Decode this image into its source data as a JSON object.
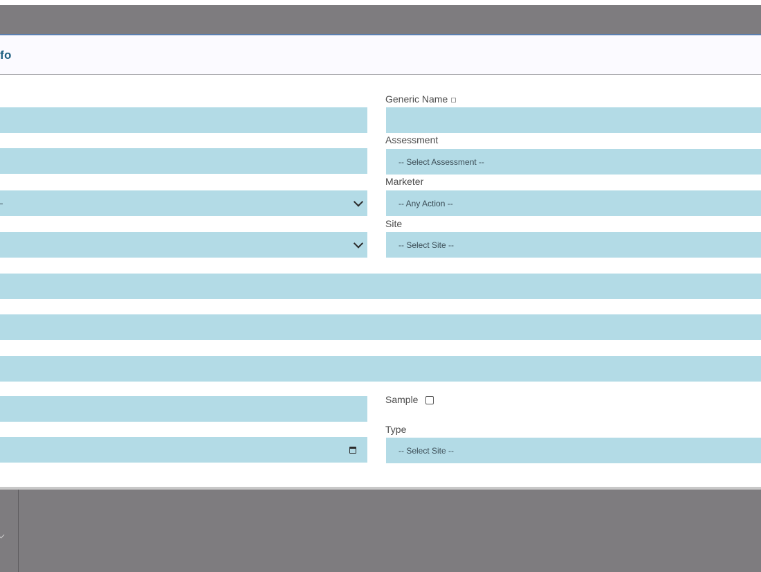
{
  "panel": {
    "title": "fo"
  },
  "fields": {
    "generic_name": {
      "label": "Generic Name",
      "value": ""
    },
    "assessment": {
      "label": "Assessment",
      "selected": "-- Select Assessment --"
    },
    "marketer": {
      "label": "Marketer",
      "selected": "-- Any Action --"
    },
    "site": {
      "label": "Site",
      "selected": "-- Select Site --"
    },
    "sample": {
      "label": "Sample",
      "checked": false
    },
    "type": {
      "label": "Type",
      "selected": "-- Select Site --"
    }
  },
  "icons": {
    "select": "chevron-down-icon",
    "date": "calendar-icon",
    "info": "info-icon"
  },
  "colors": {
    "field_bg": "#b3dbe6",
    "title": "#1d5f80",
    "backdrop": "#7e7c7f",
    "header_border": "#5b7fb0"
  }
}
